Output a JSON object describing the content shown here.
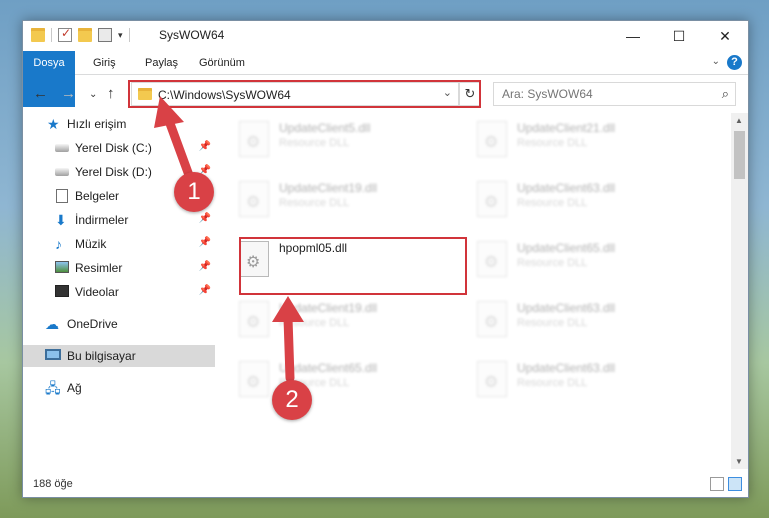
{
  "window": {
    "title": "SysWOW64"
  },
  "ribbon": {
    "tabs": [
      {
        "label": "Dosya"
      },
      {
        "label": "Giriş"
      },
      {
        "label": "Paylaş"
      },
      {
        "label": "Görünüm"
      }
    ]
  },
  "address": {
    "path": "C:\\Windows\\SysWOW64"
  },
  "search": {
    "placeholder": "Ara: SysWOW64"
  },
  "sidebar": {
    "items": [
      {
        "label": "Hızlı erişim",
        "icon": "star-icon",
        "pinned": false
      },
      {
        "label": "Yerel Disk (C:)",
        "icon": "drive-icon",
        "pinned": true
      },
      {
        "label": "Yerel Disk (D:)",
        "icon": "drive-icon",
        "pinned": true
      },
      {
        "label": "Belgeler",
        "icon": "documents-icon",
        "pinned": true
      },
      {
        "label": "İndirmeler",
        "icon": "downloads-icon",
        "pinned": true
      },
      {
        "label": "Müzik",
        "icon": "music-icon",
        "pinned": true
      },
      {
        "label": "Resimler",
        "icon": "pictures-icon",
        "pinned": true
      },
      {
        "label": "Videolar",
        "icon": "videos-icon",
        "pinned": true
      },
      {
        "label": "OneDrive",
        "icon": "onedrive-icon",
        "pinned": false
      },
      {
        "label": "Bu bilgisayar",
        "icon": "this-pc-icon",
        "pinned": false,
        "selected": true
      },
      {
        "label": "Ağ",
        "icon": "network-icon",
        "pinned": false
      }
    ]
  },
  "files": [
    {
      "name": "UpdateClient5.dll",
      "desc": "Resource DLL",
      "blurred": true
    },
    {
      "name": "UpdateClient21.dll",
      "desc": "Resource DLL",
      "blurred": true
    },
    {
      "name": "UpdateClient19.dll",
      "desc": "Resource DLL",
      "blurred": true
    },
    {
      "name": "UpdateClient63.dll",
      "desc": "Resource DLL",
      "blurred": true
    },
    {
      "name": "hpopml05.dll",
      "desc": "",
      "blurred": false
    },
    {
      "name": "UpdateClient65.dll",
      "desc": "Resource DLL",
      "blurred": true
    },
    {
      "name": "UpdateClient19.dll",
      "desc": "Resource DLL",
      "blurred": true
    },
    {
      "name": "UpdateClient63.dll",
      "desc": "Resource DLL",
      "blurred": true
    },
    {
      "name": "UpdateClient65.dll",
      "desc": "Resource DLL",
      "blurred": true
    },
    {
      "name": "UpdateClient63.dll",
      "desc": "Resource DLL",
      "blurred": true
    }
  ],
  "status": {
    "count": "188 öğe"
  },
  "annotations": {
    "step1": "1",
    "step2": "2",
    "color": "#d1343a"
  },
  "colors": {
    "accent": "#1979ca",
    "highlight": "#d1343a"
  }
}
